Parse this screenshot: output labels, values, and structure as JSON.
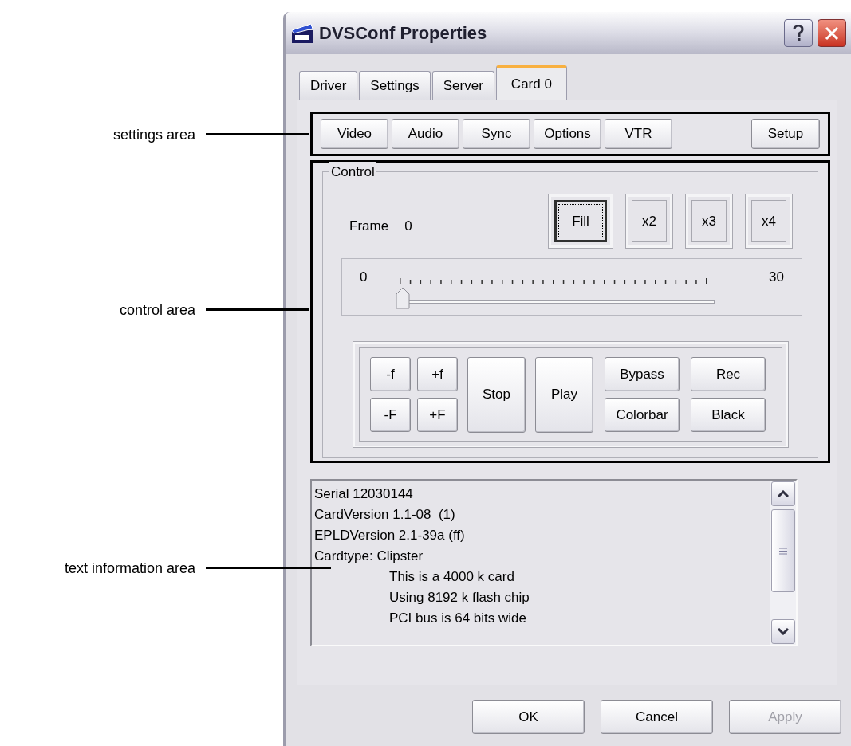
{
  "annotations": [
    {
      "label": "settings area"
    },
    {
      "label": "control area"
    },
    {
      "label": "text information area"
    }
  ],
  "window": {
    "title": "DVSConf Properties"
  },
  "tabs": [
    {
      "label": "Driver",
      "selected": false
    },
    {
      "label": "Settings",
      "selected": false
    },
    {
      "label": "Server",
      "selected": false
    },
    {
      "label": "Card 0",
      "selected": true
    }
  ],
  "settings_buttons": [
    "Video",
    "Audio",
    "Sync",
    "Options",
    "VTR"
  ],
  "setup_button": "Setup",
  "control": {
    "title": "Control",
    "frame_label": "Frame",
    "frame_value": "0",
    "zoom_buttons": [
      {
        "label": "Fill",
        "default": true
      },
      {
        "label": "x2",
        "default": false
      },
      {
        "label": "x3",
        "default": false
      },
      {
        "label": "x4",
        "default": false
      }
    ],
    "slider": {
      "min_label": "0",
      "max_label": "30",
      "level": 0
    },
    "jog_buttons": [
      "-f",
      "+f",
      "-F",
      "+F"
    ],
    "stop": "Stop",
    "play": "Play",
    "mode_buttons": [
      "Bypass",
      "Rec",
      "Colorbar",
      "Black"
    ]
  },
  "info_lines": [
    {
      "text": "Serial 12030144"
    },
    {
      "text": "CardVersion 1.1-08  (1)"
    },
    {
      "text": "EPLDVersion 2.1-39a (ff)"
    },
    {
      "text": "Cardtype: Clipster",
      "children": [
        {
          "text": "This is a 4000 k card"
        },
        {
          "text": "Using 8192 k flash chip"
        },
        {
          "text": "PCI bus is 64 bits wide"
        }
      ]
    }
  ],
  "buttons": [
    {
      "label": "OK",
      "disabled": false
    },
    {
      "label": "Cancel",
      "disabled": false
    },
    {
      "label": "Apply",
      "disabled": true
    }
  ]
}
